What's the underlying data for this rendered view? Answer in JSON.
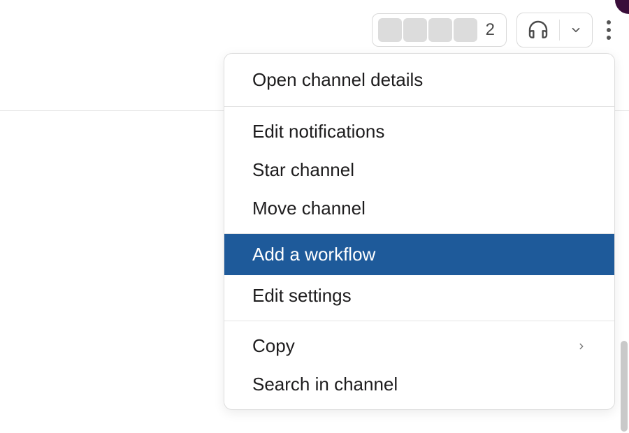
{
  "header": {
    "member_count": "2"
  },
  "menu": {
    "open_details": "Open channel details",
    "edit_notifications": "Edit notifications",
    "star_channel": "Star channel",
    "move_channel": "Move channel",
    "add_workflow": "Add a workflow",
    "edit_settings": "Edit settings",
    "copy": "Copy",
    "search_in_channel": "Search in channel"
  },
  "colors": {
    "highlight": "#1e5a9a"
  }
}
